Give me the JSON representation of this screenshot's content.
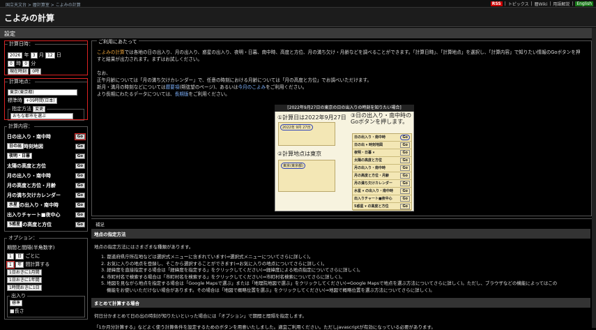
{
  "breadcrumb": {
    "items": [
      "国立天文台",
      "暦計算室",
      "こよみの計算"
    ],
    "sep": " > "
  },
  "toplinks": {
    "rss": "RSS",
    "items": [
      "トピックス",
      "暦Wiki",
      "用語解説"
    ],
    "english": "English"
  },
  "page_title": "こよみの計算",
  "settings_label": "設定",
  "datetime": {
    "legend": "計算日時：",
    "year": "2026",
    "year_unit": "年",
    "month": "3",
    "month_unit": "月",
    "day": "12",
    "day_unit": "日",
    "hour": "0",
    "hour_unit": "時",
    "minute": "0",
    "minute_unit": "分",
    "now_btn": "現在時刻",
    "zero_btn": "0時"
  },
  "place": {
    "legend": "計算地点：",
    "city": "東京(東京都)",
    "tz_label": "標準時",
    "tz": "+09時間(日本)",
    "method_legend": "指定方法",
    "change_btn": "変更",
    "method": "おもな都市を選ぶ"
  },
  "calc": {
    "legend": "計算内容：",
    "items": [
      {
        "label": "日の出入り・南中時",
        "go": "Go"
      },
      {
        "label": "日の出",
        "select": true,
        "suffix": "時刻地図",
        "go": "Go"
      },
      {
        "label": "夜明・日暮",
        "select": true,
        "suffix": "",
        "go": "Go"
      },
      {
        "label": "太陽の高度と方位",
        "go": "Go"
      },
      {
        "label": "月の出入り・南中時",
        "go": "Go"
      },
      {
        "label": "月の高度と方位・月齢",
        "go": "Go"
      },
      {
        "label": "月の満ち欠けカレンダー",
        "go": "Go"
      },
      {
        "label": "水星",
        "select": true,
        "suffix": "の出入り・南中時",
        "go": "Go"
      },
      {
        "label": "出入りチャート■夜中心",
        "go": "Go"
      },
      {
        "label": "5惑星",
        "select": true,
        "suffix": "の高度と方位",
        "go": "Go"
      }
    ]
  },
  "options": {
    "legend": "オプション：",
    "period_label": "期間と間隔(半角数字)",
    "count": "1",
    "count_unit": "日",
    "every": "ごとに",
    "interval": "1",
    "interval_unit": "年",
    "interval_suffix": "間計算する",
    "presets": [
      "1日おきに1月間",
      "1日おきに1年間",
      "1時間おきに1日"
    ],
    "out_legend": "出入り",
    "standard": "標準",
    "length": "■長さ"
  },
  "usage": {
    "legend": "ご利用にあたって",
    "p1a": "こよみの計算",
    "p1b": "では各地の日の出入り、月の出入り、惑星の出入り、夜明・日暮、南中時、高度と方位、月の満ち欠け・月齢などを調べることができます。「計算日時」、「計算地点」を選択し、「計算内容」で知りたい情報のGoボタンを押すと結果が出力されます。まずはお試しください。",
    "p2": "なお、",
    "p3": "正午月齢については「月の満ち欠けカレンダー」で、任意の時刻における月齢については「月の高度と方位」でお調べいただけます。",
    "p4a": "新月・満月の時刻などについては",
    "p4l1": "暦要項",
    "p4b": "(朔弦望のページ)、あるいは",
    "p4l2": "今月のこよみ",
    "p4c": "をご利用ください。",
    "p5a": "より長期にわたるデータについては、",
    "p5l": "長期版",
    "p5b": "をご利用ください。"
  },
  "figure": {
    "caption": "[2022年9月27日の東京の日の出入りの時刻を知りたい場合]",
    "step1": "①計算日は2022年9月27日",
    "step2": "②計算地点は東京",
    "step3": "③日の出入り・南中時のGoボタンを押します。",
    "mini_year": "2022",
    "mini_month": "9",
    "mini_day": "27",
    "mini_city": "東京(東京都)",
    "mini_items": [
      "日の出入り・南中時",
      "日の出 ▾ 時刻地図",
      "夜明・日暮 ▾",
      "太陽の高度と方位",
      "月の出入り・南中時",
      "月の高度と方位・月齢",
      "月の満ち欠けカレンダー",
      "水星 ▾ の出入り・南中時",
      "出入りチャート■夜中心",
      "5惑星 ▾ の高度と方位"
    ]
  },
  "supplement": {
    "legend": "補足",
    "h1": "地点の指定方法",
    "intro": "地点の指定方法にはさまざまな種類があります。",
    "items": [
      "1. 都道府県庁所在地などは選択式メニューに含まれています(⇒選択式メニューについてさらに詳しく)。",
      "2. お気に入りの地点を登録し、そこから選択することができます(⇒お気に入りの地点についてさらに詳しく)。",
      "3. 経緯度を直接指定する場合は「経緯度を指定する」をクリックしてください(⇒経緯度による地点指定についてさらに詳しく)。",
      "4. 市町村名で検索する場合は「市町村名を検索する」をクリックしてください(⇒市町村名検索についてさらに詳しく)。",
      "5. 地図を見ながら地点を指定する場合は「Google Mapsで選ぶ」または「地理院地図で選ぶ」をクリックしてください(⇒Google Mapsで地点を選ぶ方法についてさらに詳しく)。ただし、ブラウザなどの機能によってはこの",
      "機能をお使いいただけない場合があります。その場合は「地図で概略位置を選ぶ」をクリックしてください(⇒地図で概略位置を選ぶ方法についてさらに詳しく)。"
    ],
    "h2": "まとめて計算する場合",
    "p2": "何日分かまとめて日の出の時刻が知りたいといった場合には「オプション」で期間と間隔を指定します。",
    "p3": "「1か月分計算する」などよく使う計算条件を設定するためのボタンを用意いたしました。適宜ご利用ください。ただしjavascriptが有効になっている必要があります。"
  }
}
